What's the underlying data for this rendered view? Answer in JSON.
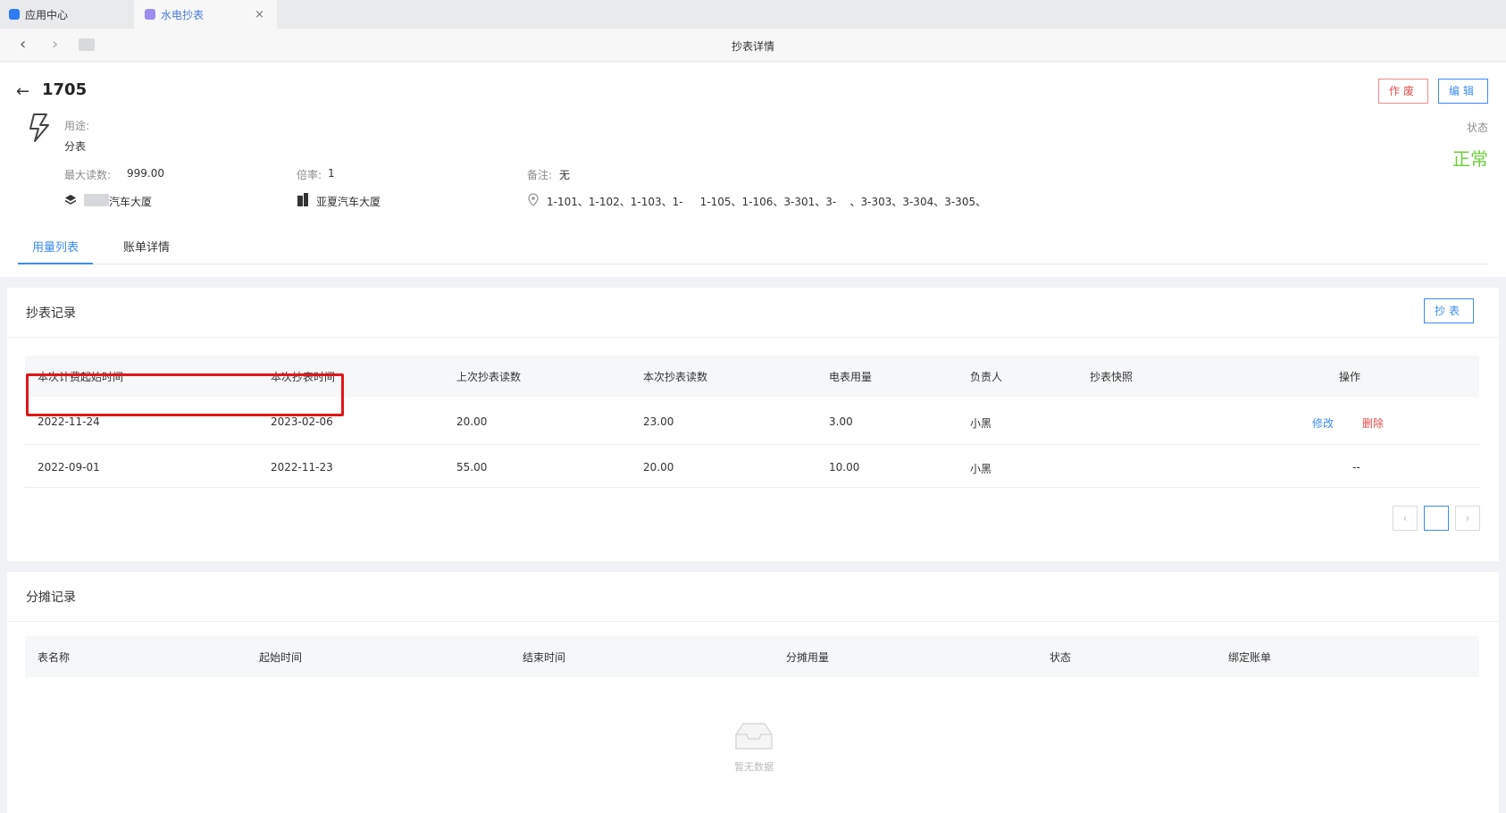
{
  "tabs": [
    {
      "label": "应用中心"
    },
    {
      "label": "水电抄表",
      "close": "×"
    }
  ],
  "nav": {
    "back": "‹",
    "forward": "›",
    "title": "抄表详情"
  },
  "header": {
    "back_icon": "←",
    "meter_no": "1705",
    "usage_label": "用途:",
    "usage_value": "分表",
    "max_reading_label": "最大读数:",
    "max_reading_value": "999.00",
    "rate_label": "倍率:",
    "rate_value": "1",
    "remark_label": "备注:",
    "remark_value": "无",
    "building1": "汽车大厦",
    "building2": "亚夏汽车大厦",
    "rooms": "1-101、1-102、1-103、1-     1-105、1-106、3-301、3-    、3-303、3-304、3-305、",
    "void_button": "作废",
    "edit_button": "编辑",
    "status_label": "状态",
    "status_value": "正常",
    "status_color": "#6fce3e"
  },
  "subtabs": {
    "usage": "用量列表",
    "bill": "账单详情"
  },
  "meter_records": {
    "title": "抄表记录",
    "read_button": "抄表",
    "columns": [
      "本次计费起始时间",
      "本次抄表时间",
      "上次抄表读数",
      "本次抄表读数",
      "电表用量",
      "负责人",
      "抄表快照",
      "操作"
    ],
    "rows": [
      {
        "start": "2022-11-24",
        "read_time": "2023-02-06",
        "prev": "20.00",
        "curr": "23.00",
        "usage": "3.00",
        "owner": "小黑",
        "edit": "修改",
        "delete": "删除"
      },
      {
        "start": "2022-09-01",
        "read_time": "2022-11-23",
        "prev": "55.00",
        "curr": "20.00",
        "usage": "10.00",
        "owner": "小黑",
        "ops": "--"
      }
    ],
    "pagination": {
      "prev": "‹",
      "page": "",
      "next": "›"
    }
  },
  "alloc_records": {
    "title": "分摊记录",
    "columns": [
      "表名称",
      "起始时间",
      "结束时间",
      "分摊用量",
      "状态",
      "绑定账单"
    ],
    "empty_text": "暂无数据"
  }
}
